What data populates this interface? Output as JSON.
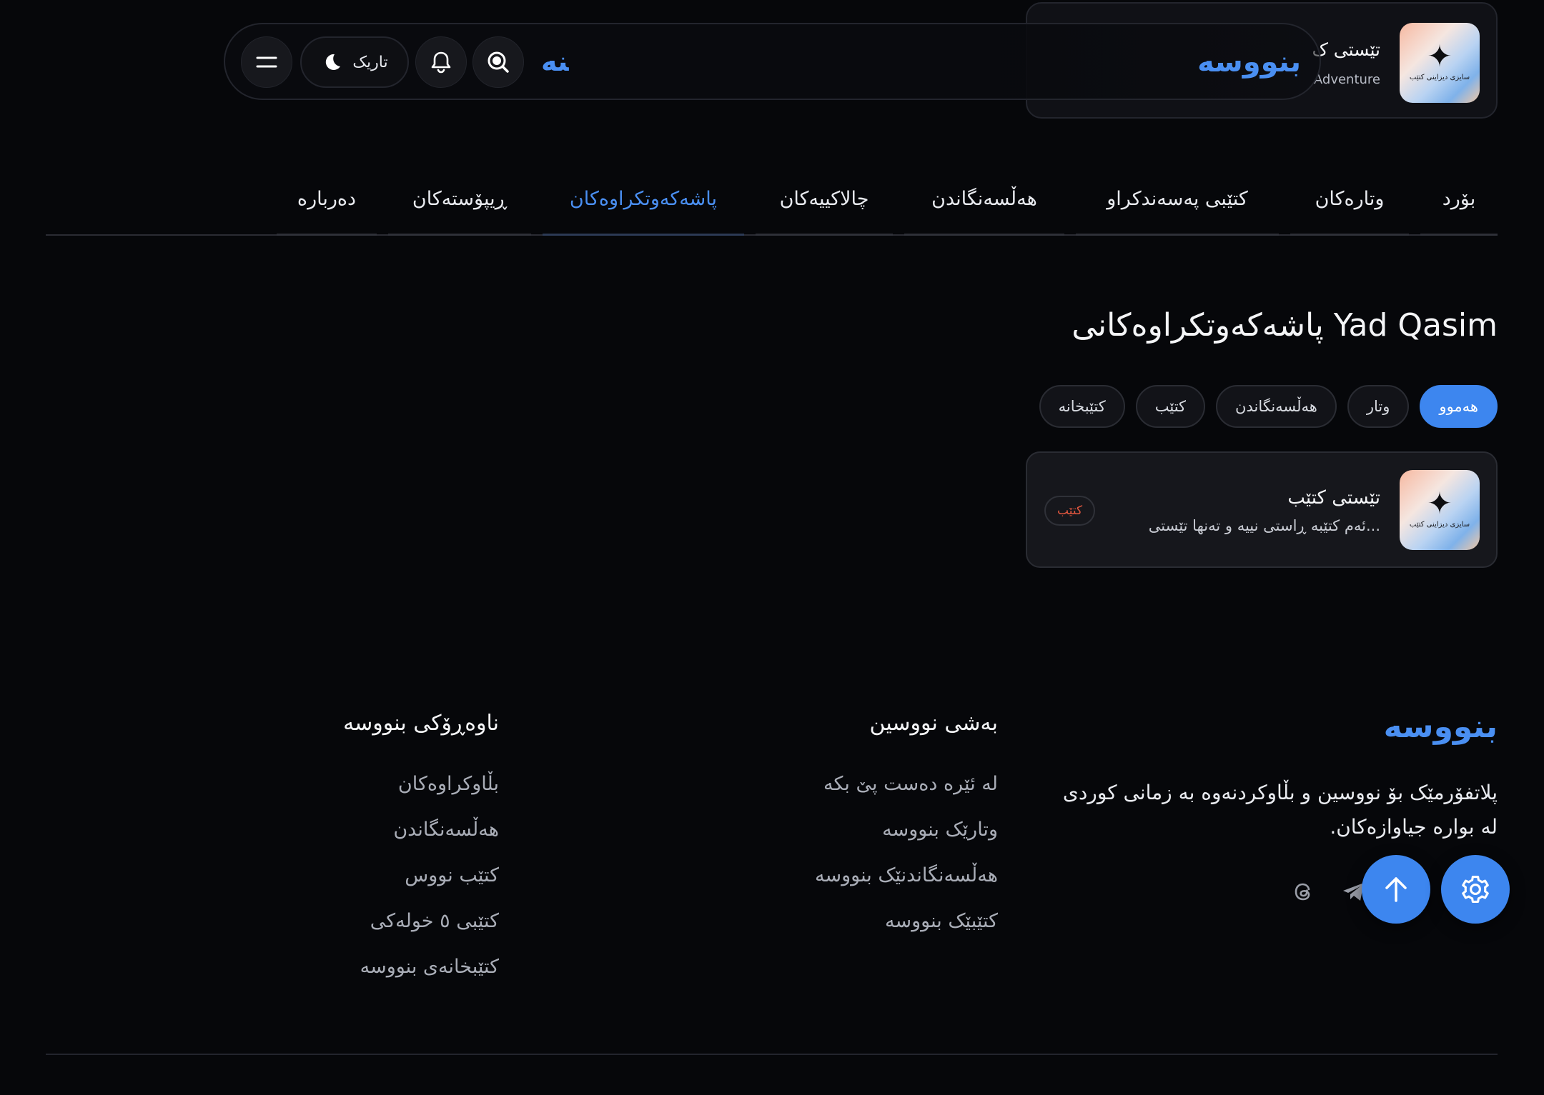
{
  "header": {
    "brand": "بنووسە",
    "brand_mark": "ﻨﻪ",
    "theme_label": "تاریک",
    "profile": {
      "name": "تێستی ک",
      "subtitle": "Adventure",
      "cover_caption": "سایزی دیزاینی کتێب"
    }
  },
  "tabs": [
    {
      "label": "بۆرد",
      "active": false
    },
    {
      "label": "وتارەکان",
      "active": false
    },
    {
      "label": "کتێبی پەسەندکراو",
      "active": false
    },
    {
      "label": "هەڵسەنگاندن",
      "active": false
    },
    {
      "label": "چالاکییەکان",
      "active": false
    },
    {
      "label": "پاشەکەوتکراوەکان",
      "active": true
    },
    {
      "label": "ڕیپۆستەکان",
      "active": false
    },
    {
      "label": "دەربارە",
      "active": false
    }
  ],
  "main": {
    "title": "پاشەکەوتکراوەکانی Yad Qasim",
    "filters": [
      {
        "label": "هەموو",
        "active": true
      },
      {
        "label": "وتار",
        "active": false
      },
      {
        "label": "هەڵسەنگاندن",
        "active": false
      },
      {
        "label": "کتێب",
        "active": false
      },
      {
        "label": "کتێبخانە",
        "active": false
      }
    ],
    "items": [
      {
        "title": "تێستی کتێب",
        "description": "ئەم کتێبە ڕاستی نییە و تەنها تێستی...",
        "type": "کتێب",
        "cover_caption": "سایزی دیزاینی کتێب"
      }
    ]
  },
  "footer": {
    "brand": "بنووسە",
    "about": "پلاتفۆرمێک بۆ نووسین و بڵاوکردنەوە بە زمانی کوردی لە بوارە جیاوازەکان.",
    "writing": {
      "heading": "بەشی نووسین",
      "links": [
        "لە ئێرە دەست پێ بکە",
        "وتارێک بنووسە",
        "هەڵسەنگاندنێک بنووسە",
        "کتێبێک بنووسە"
      ]
    },
    "content": {
      "heading": "ناوەڕۆکی بنووسە",
      "links": [
        "بڵاوکراوەکان",
        "هەڵسەنگاندن",
        "کتێب نووس",
        "کتێبی ٥ خولەکی",
        "کتێبخانەی بنووسە"
      ]
    }
  },
  "colors": {
    "accent": "#4a8ff2",
    "background": "#06070a",
    "card": "#16171c",
    "badge_text": "#e2573f"
  }
}
